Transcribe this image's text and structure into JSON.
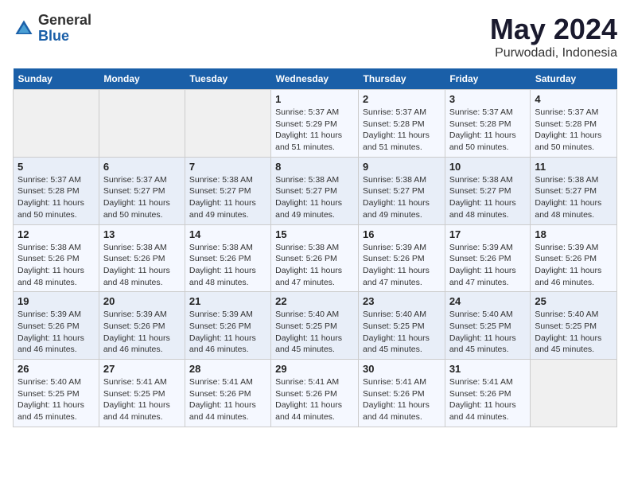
{
  "logo": {
    "general": "General",
    "blue": "Blue"
  },
  "title": "May 2024",
  "subtitle": "Purwodadi, Indonesia",
  "days_of_week": [
    "Sunday",
    "Monday",
    "Tuesday",
    "Wednesday",
    "Thursday",
    "Friday",
    "Saturday"
  ],
  "weeks": [
    [
      {
        "day": "",
        "info": ""
      },
      {
        "day": "",
        "info": ""
      },
      {
        "day": "",
        "info": ""
      },
      {
        "day": "1",
        "info": "Sunrise: 5:37 AM\nSunset: 5:29 PM\nDaylight: 11 hours\nand 51 minutes."
      },
      {
        "day": "2",
        "info": "Sunrise: 5:37 AM\nSunset: 5:28 PM\nDaylight: 11 hours\nand 51 minutes."
      },
      {
        "day": "3",
        "info": "Sunrise: 5:37 AM\nSunset: 5:28 PM\nDaylight: 11 hours\nand 50 minutes."
      },
      {
        "day": "4",
        "info": "Sunrise: 5:37 AM\nSunset: 5:28 PM\nDaylight: 11 hours\nand 50 minutes."
      }
    ],
    [
      {
        "day": "5",
        "info": "Sunrise: 5:37 AM\nSunset: 5:28 PM\nDaylight: 11 hours\nand 50 minutes."
      },
      {
        "day": "6",
        "info": "Sunrise: 5:37 AM\nSunset: 5:27 PM\nDaylight: 11 hours\nand 50 minutes."
      },
      {
        "day": "7",
        "info": "Sunrise: 5:38 AM\nSunset: 5:27 PM\nDaylight: 11 hours\nand 49 minutes."
      },
      {
        "day": "8",
        "info": "Sunrise: 5:38 AM\nSunset: 5:27 PM\nDaylight: 11 hours\nand 49 minutes."
      },
      {
        "day": "9",
        "info": "Sunrise: 5:38 AM\nSunset: 5:27 PM\nDaylight: 11 hours\nand 49 minutes."
      },
      {
        "day": "10",
        "info": "Sunrise: 5:38 AM\nSunset: 5:27 PM\nDaylight: 11 hours\nand 48 minutes."
      },
      {
        "day": "11",
        "info": "Sunrise: 5:38 AM\nSunset: 5:27 PM\nDaylight: 11 hours\nand 48 minutes."
      }
    ],
    [
      {
        "day": "12",
        "info": "Sunrise: 5:38 AM\nSunset: 5:26 PM\nDaylight: 11 hours\nand 48 minutes."
      },
      {
        "day": "13",
        "info": "Sunrise: 5:38 AM\nSunset: 5:26 PM\nDaylight: 11 hours\nand 48 minutes."
      },
      {
        "day": "14",
        "info": "Sunrise: 5:38 AM\nSunset: 5:26 PM\nDaylight: 11 hours\nand 48 minutes."
      },
      {
        "day": "15",
        "info": "Sunrise: 5:38 AM\nSunset: 5:26 PM\nDaylight: 11 hours\nand 47 minutes."
      },
      {
        "day": "16",
        "info": "Sunrise: 5:39 AM\nSunset: 5:26 PM\nDaylight: 11 hours\nand 47 minutes."
      },
      {
        "day": "17",
        "info": "Sunrise: 5:39 AM\nSunset: 5:26 PM\nDaylight: 11 hours\nand 47 minutes."
      },
      {
        "day": "18",
        "info": "Sunrise: 5:39 AM\nSunset: 5:26 PM\nDaylight: 11 hours\nand 46 minutes."
      }
    ],
    [
      {
        "day": "19",
        "info": "Sunrise: 5:39 AM\nSunset: 5:26 PM\nDaylight: 11 hours\nand 46 minutes."
      },
      {
        "day": "20",
        "info": "Sunrise: 5:39 AM\nSunset: 5:26 PM\nDaylight: 11 hours\nand 46 minutes."
      },
      {
        "day": "21",
        "info": "Sunrise: 5:39 AM\nSunset: 5:26 PM\nDaylight: 11 hours\nand 46 minutes."
      },
      {
        "day": "22",
        "info": "Sunrise: 5:40 AM\nSunset: 5:25 PM\nDaylight: 11 hours\nand 45 minutes."
      },
      {
        "day": "23",
        "info": "Sunrise: 5:40 AM\nSunset: 5:25 PM\nDaylight: 11 hours\nand 45 minutes."
      },
      {
        "day": "24",
        "info": "Sunrise: 5:40 AM\nSunset: 5:25 PM\nDaylight: 11 hours\nand 45 minutes."
      },
      {
        "day": "25",
        "info": "Sunrise: 5:40 AM\nSunset: 5:25 PM\nDaylight: 11 hours\nand 45 minutes."
      }
    ],
    [
      {
        "day": "26",
        "info": "Sunrise: 5:40 AM\nSunset: 5:25 PM\nDaylight: 11 hours\nand 45 minutes."
      },
      {
        "day": "27",
        "info": "Sunrise: 5:41 AM\nSunset: 5:25 PM\nDaylight: 11 hours\nand 44 minutes."
      },
      {
        "day": "28",
        "info": "Sunrise: 5:41 AM\nSunset: 5:26 PM\nDaylight: 11 hours\nand 44 minutes."
      },
      {
        "day": "29",
        "info": "Sunrise: 5:41 AM\nSunset: 5:26 PM\nDaylight: 11 hours\nand 44 minutes."
      },
      {
        "day": "30",
        "info": "Sunrise: 5:41 AM\nSunset: 5:26 PM\nDaylight: 11 hours\nand 44 minutes."
      },
      {
        "day": "31",
        "info": "Sunrise: 5:41 AM\nSunset: 5:26 PM\nDaylight: 11 hours\nand 44 minutes."
      },
      {
        "day": "",
        "info": ""
      }
    ]
  ]
}
